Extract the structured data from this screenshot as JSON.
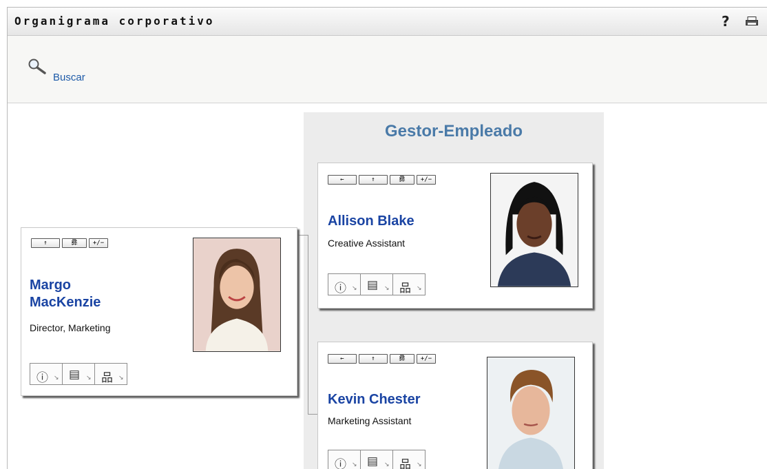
{
  "header": {
    "title": "Organigrama corporativo",
    "help_icon": "?",
    "print_icon": "printer-icon"
  },
  "search": {
    "label": "Buscar",
    "icon": "magnifier-icon"
  },
  "column": {
    "title": "Gestor-Empleado"
  },
  "cards": {
    "margo": {
      "first_name": "Margo",
      "last_name": "MacKenzie",
      "role": "Director, Marketing",
      "toolbar": [
        "↑",
        "彞",
        "+/−"
      ]
    },
    "allison": {
      "name": "Allison Blake",
      "role": "Creative Assistant",
      "toolbar": [
        "←",
        "↑",
        "彞",
        "+/−"
      ]
    },
    "kevin": {
      "name": "Kevin Chester",
      "role": "Marketing Assistant",
      "toolbar": [
        "←",
        "↑",
        "彞",
        "+/−"
      ]
    }
  },
  "action_icons": [
    "info-icon",
    "email-icon",
    "org-chart-icon"
  ],
  "colors": {
    "link": "#1a44a3",
    "column_title": "#4a7aa8",
    "column_bg": "#ececec"
  }
}
